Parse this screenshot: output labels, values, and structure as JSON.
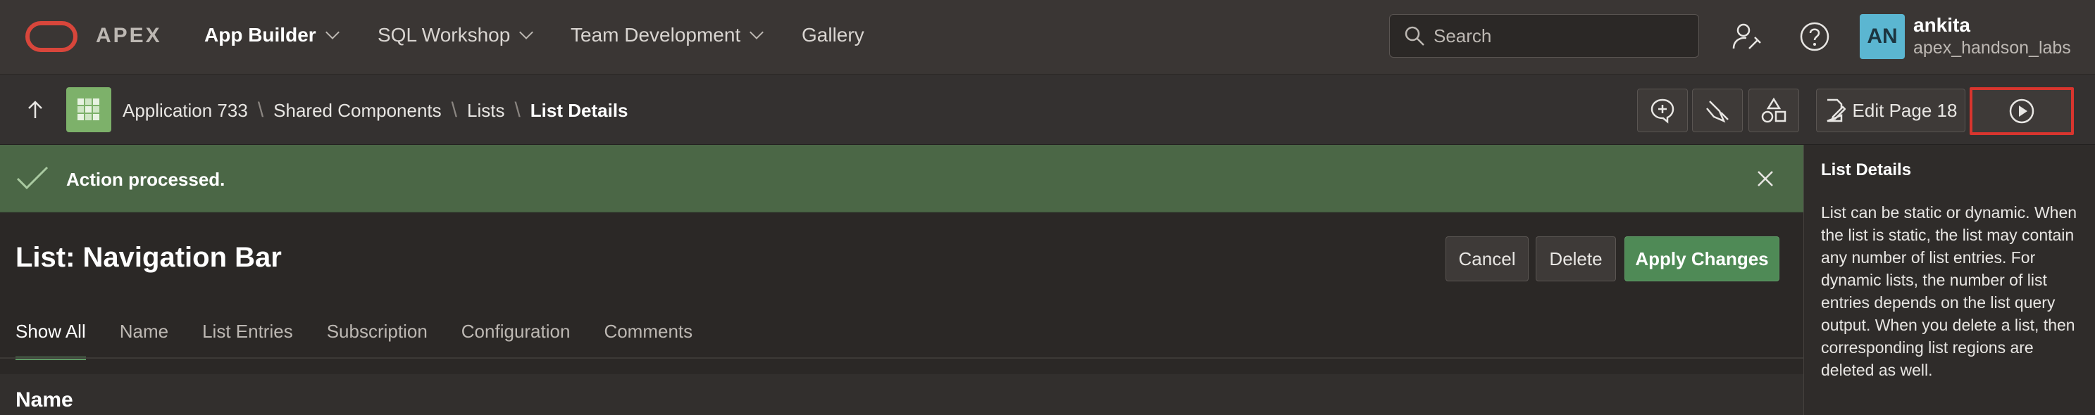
{
  "header": {
    "brand": "APEX",
    "nav": [
      {
        "label": "App Builder",
        "active": true,
        "has_menu": true
      },
      {
        "label": "SQL Workshop",
        "active": false,
        "has_menu": true
      },
      {
        "label": "Team Development",
        "active": false,
        "has_menu": true
      },
      {
        "label": "Gallery",
        "active": false,
        "has_menu": false
      }
    ],
    "search": {
      "placeholder": "Search"
    },
    "icons": [
      "administration-icon",
      "help-icon"
    ],
    "user": {
      "initials": "AN",
      "name": "ankita",
      "workspace": "apex_handson_labs"
    }
  },
  "breadcrumb": {
    "items": [
      "Application 733",
      "Shared Components",
      "Lists"
    ],
    "current": "List Details"
  },
  "toolbar": {
    "icons": [
      "comment-icon",
      "developer-tools-icon",
      "shared-components-icon"
    ],
    "edit_page_label": "Edit Page 18",
    "run_icon": "play-icon"
  },
  "alert": {
    "message": "Action processed.",
    "status_color": "#4b6746"
  },
  "page": {
    "title": "List: Navigation Bar",
    "buttons": {
      "cancel": "Cancel",
      "delete": "Delete",
      "apply": "Apply Changes"
    },
    "tabs": [
      "Show All",
      "Name",
      "List Entries",
      "Subscription",
      "Configuration",
      "Comments"
    ],
    "active_tab": "Show All",
    "section_title": "Name"
  },
  "help": {
    "title": "List Details",
    "body": "List can be static or dynamic. When the list is static, the list may contain any number of list entries. For dynamic lists, the number of list entries depends on the list query output. When you delete a list, then corresponding list regions are deleted as well."
  },
  "colors": {
    "accent": "#4f8a56",
    "logo": "#d8463b",
    "highlight": "#d8352e"
  }
}
